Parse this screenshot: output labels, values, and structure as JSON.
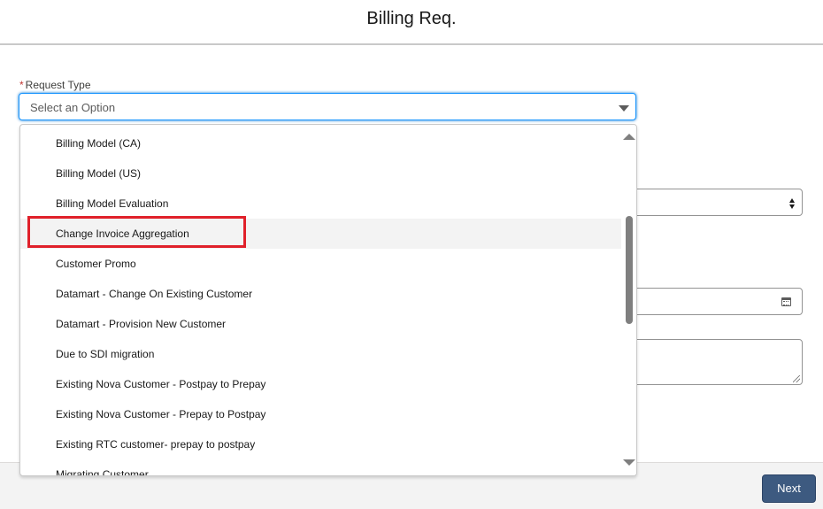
{
  "header": {
    "title": "Billing Req."
  },
  "form": {
    "request_type": {
      "label": "Request Type",
      "required_marker": "*",
      "placeholder": "Select an Option"
    }
  },
  "dropdown": {
    "options": [
      "Billing Model (CA)",
      "Billing Model (US)",
      "Billing Model Evaluation",
      "Change Invoice Aggregation",
      "Customer Promo",
      "Datamart - Change On Existing Customer",
      "Datamart - Provision New Customer",
      "Due to SDI migration",
      "Existing Nova Customer - Postpay to Prepay",
      "Existing Nova Customer - Prepay to Postpay",
      "Existing RTC customer- prepay to postpay",
      "Migrating Customer"
    ],
    "highlighted_index": 3
  },
  "footer": {
    "next_label": "Next"
  },
  "colors": {
    "accent": "#0176d3",
    "button": "#3d5a80",
    "annotation": "#e0202a",
    "required": "#c23934"
  },
  "icons": {
    "combobox": "chevron-down-icon",
    "scroll_up": "scroll-up-icon",
    "scroll_down": "scroll-down-icon",
    "calendar": "calendar-icon"
  }
}
